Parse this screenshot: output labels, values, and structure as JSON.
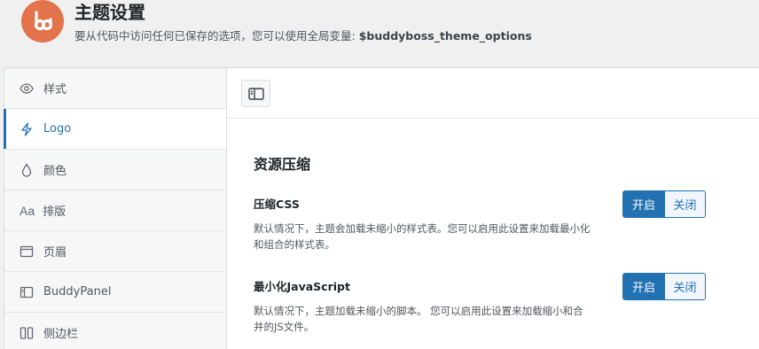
{
  "header": {
    "title": "主题设置",
    "subtitle_prefix": "要从代码中访问任何已保存的选项，您可以使用全局变量:",
    "subtitle_var": "$buddyboss_theme_options",
    "logo_icon": "buddyboss-logo-icon",
    "logo_color": "#e2734a"
  },
  "sidebar": {
    "items": [
      {
        "label": "样式",
        "icon": "eye-icon",
        "active": false
      },
      {
        "label": "Logo",
        "icon": "bolt-icon",
        "active": true
      },
      {
        "label": "颜色",
        "icon": "droplet-icon",
        "active": false
      },
      {
        "label": "排版",
        "icon": "typography-icon",
        "active": false
      },
      {
        "label": "页眉",
        "icon": "window-icon",
        "active": false
      },
      {
        "label": "BuddyPanel",
        "icon": "panel-icon",
        "active": false
      },
      {
        "label": "侧边栏",
        "icon": "columns-icon",
        "active": false
      }
    ]
  },
  "main": {
    "section_title": "资源压缩",
    "settings": [
      {
        "label": "压缩CSS",
        "description": "默认情况下，主题会加载未缩小的样式表。您可以启用此设置来加载最小化和组合的样式表。",
        "on_label": "开启",
        "off_label": "关闭",
        "value": "开启"
      },
      {
        "label": "最小化JavaScript",
        "description": "默认情况下，主题加载未缩小的脚本。 您可以启用此设置来加载缩小和合并的JS文件。",
        "on_label": "开启",
        "off_label": "关闭",
        "value": "开启"
      }
    ]
  },
  "colors": {
    "accent": "#2271b1",
    "brand": "#e2734a"
  }
}
